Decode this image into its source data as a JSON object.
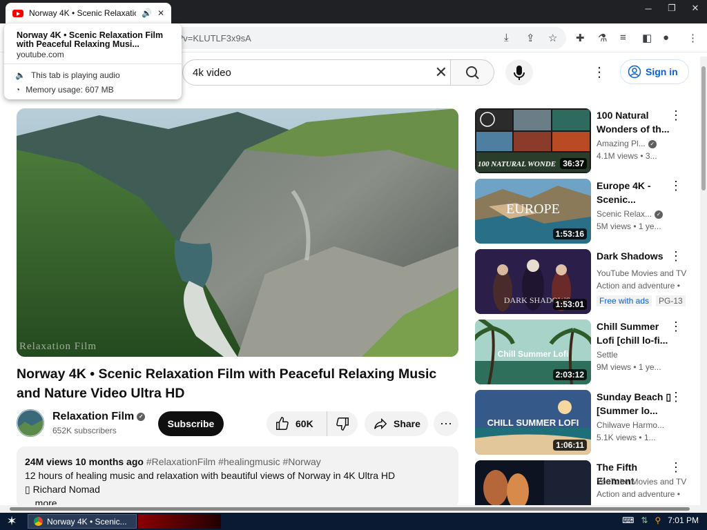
{
  "browser": {
    "tab_title": "Norway 4K • Scenic Relaxation",
    "url_fragment": "?v=KLUTLF3x9sA",
    "tooltip": {
      "title": "Norway 4K • Scenic Relaxation Film with Peaceful Relaxing Musi...",
      "domain": "youtube.com",
      "audio": "This tab is playing audio",
      "memory": "Memory usage: 607 MB"
    }
  },
  "header": {
    "search_value": "4k video",
    "signin_label": "Sign in"
  },
  "video": {
    "watermark": "Relaxation Film",
    "title": "Norway 4K • Scenic Relaxation Film with Peaceful Relaxing Music and Nature Video Ultra HD",
    "channel": "Relaxation Film",
    "subscribers": "652K subscribers",
    "subscribe_label": "Subscribe",
    "likes": "60K",
    "share_label": "Share",
    "views": "24M views",
    "age": "10 months ago",
    "tags": "#RelaxationFilm #healingmusic #Norway",
    "desc_line1": "12 hours of healing music and relaxation with beautiful views of Norway in 4K Ultra HD",
    "desc_line2": "▯ Richard Nomad",
    "more_label": "...more"
  },
  "recommendations": [
    {
      "title": "100 Natural Wonders of th...",
      "channel": "Amazing Pl...",
      "meta": "4.1M views • 3...",
      "duration": "36:37",
      "thumb_text": "100 NATURAL WONDE",
      "verified": true
    },
    {
      "title": "Europe 4K - Scenic...",
      "channel": "Scenic Relax...",
      "meta": "5M views • 1 ye...",
      "duration": "1:53:16",
      "thumb_text": "EUROPE",
      "verified": true
    },
    {
      "title": "Dark Shadows",
      "channel": "YouTube Movies and TV",
      "meta": "Action and adventure •",
      "duration": "1:53:01",
      "thumb_text": "DARK SHADOWS",
      "badge": "Free with ads",
      "rating": "PG-13"
    },
    {
      "title": "Chill Summer Lofi [chill lo-fi...",
      "channel": "Settle",
      "meta": "9M views • 1 ye...",
      "duration": "2:03:12",
      "thumb_text": "Chill Summer Lofi"
    },
    {
      "title": "Sunday Beach ▯ [Summer lo...",
      "channel": "Chilwave Harmo...",
      "meta": "5.1K views • 1...",
      "duration": "1:06:11",
      "thumb_text": "CHILL SUMMER LOFI"
    },
    {
      "title": "The Fifth Element",
      "channel": "YouTube Movies and TV",
      "meta": "Action and adventure •",
      "duration": "",
      "thumb_text": ""
    }
  ],
  "taskbar": {
    "window_label": "Norway 4K • Scenic...",
    "clock": "7:01 PM"
  }
}
